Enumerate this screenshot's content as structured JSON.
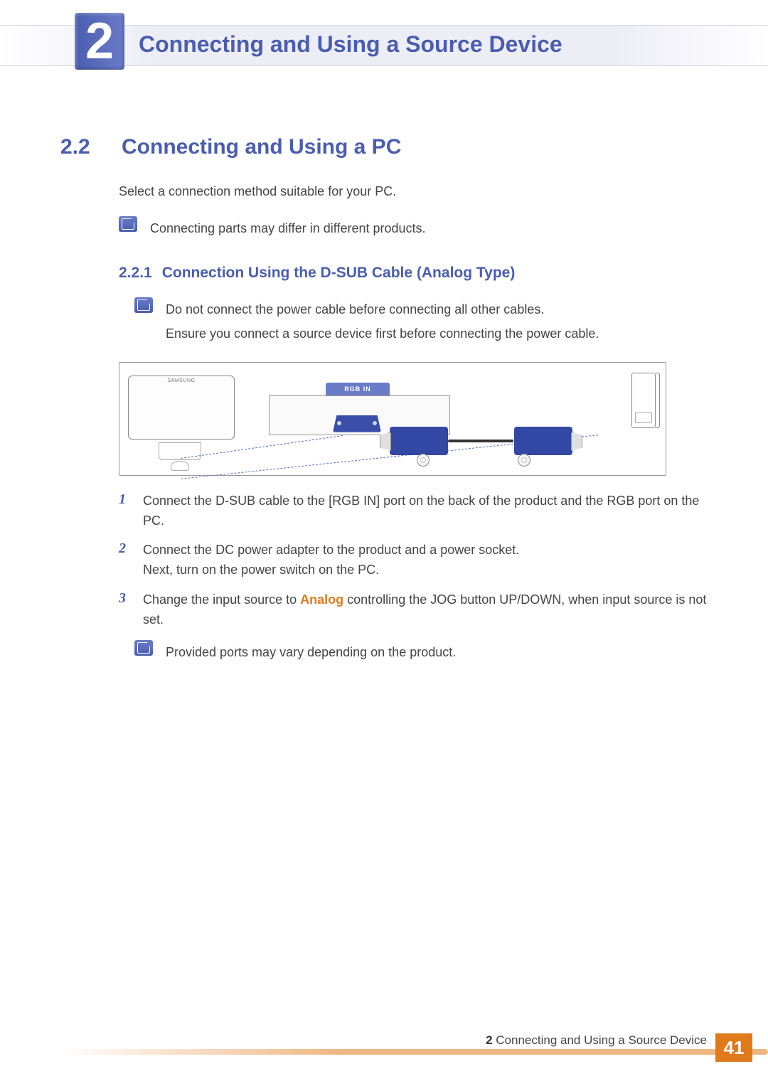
{
  "chapter": {
    "number": "2",
    "title": "Connecting and Using a Source Device"
  },
  "section": {
    "number": "2.2",
    "title": "Connecting and Using a PC",
    "intro": "Select a connection method suitable for your PC.",
    "note1": "Connecting parts may differ in different products."
  },
  "subsection": {
    "number": "2.2.1",
    "title": "Connection Using the D-SUB Cable (Analog Type)",
    "warn_line1": "Do not connect the power cable before connecting all other cables.",
    "warn_line2": "Ensure you connect a source device first before connecting the power cable."
  },
  "diagram": {
    "port_label": "RGB IN",
    "monitor_brand": "SAMSUNG"
  },
  "steps": [
    {
      "n": "1",
      "text_a": "Connect the D-SUB cable to the [RGB IN] port on the back of the product and the RGB port on the PC."
    },
    {
      "n": "2",
      "text_a": "Connect the DC power adapter to the product and a power socket.",
      "text_b": "Next, turn on the power switch on the PC."
    },
    {
      "n": "3",
      "text_a": "Change the input source to ",
      "highlight": "Analog",
      "text_c": " controlling the JOG button UP/DOWN, when input source is not set."
    }
  ],
  "post_note": "Provided ports may vary depending on the product.",
  "footer": {
    "chapter_num": "2",
    "chapter_title": "Connecting and Using a Source Device",
    "page": "41"
  }
}
